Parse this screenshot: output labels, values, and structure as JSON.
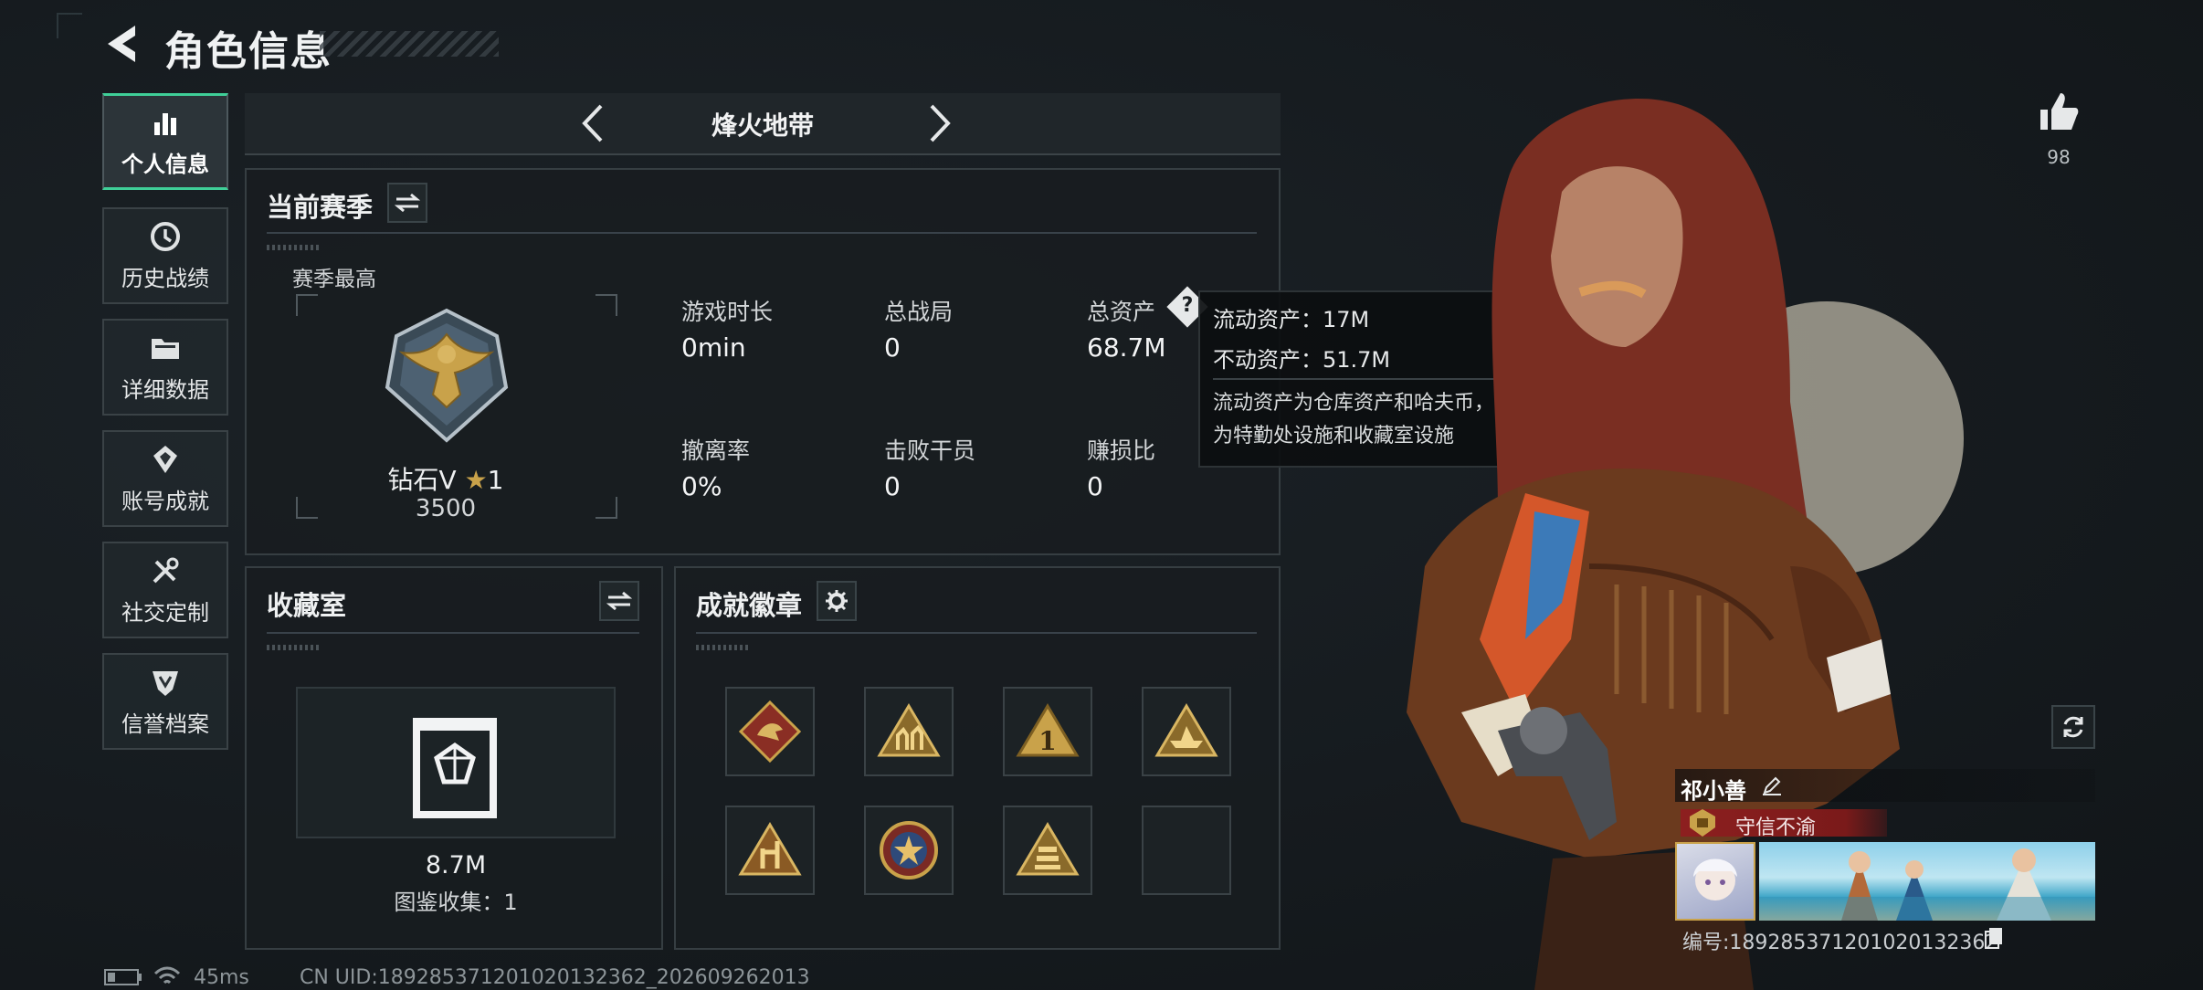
{
  "header": {
    "title": "角色信息"
  },
  "sidebar": {
    "items": [
      {
        "label": "个人信息",
        "icon": "bar-chart-icon",
        "active": true
      },
      {
        "label": "历史战绩",
        "icon": "clock-icon"
      },
      {
        "label": "详细数据",
        "icon": "folder-icon"
      },
      {
        "label": "账号成就",
        "icon": "achievement-icon"
      },
      {
        "label": "社交定制",
        "icon": "tools-icon"
      },
      {
        "label": "信誉档案",
        "icon": "shield-icon"
      }
    ]
  },
  "mode_selector": {
    "label": "烽火地带"
  },
  "season": {
    "title": "当前赛季",
    "best_label": "赛季最高",
    "rank_name": "钻石V",
    "rank_stars": "1",
    "rank_points": "3500",
    "stats": [
      {
        "label": "游戏时长",
        "value": "0min"
      },
      {
        "label": "总战局",
        "value": "0"
      },
      {
        "label": "总资产",
        "value": "68.7M"
      },
      {
        "label": "撤离率",
        "value": "0%"
      },
      {
        "label": "击败干员",
        "value": "0"
      },
      {
        "label": "赚损比",
        "value": "0"
      }
    ]
  },
  "tooltip": {
    "liquid": "流动资产：17M",
    "fixed": "不动资产：51.7M",
    "desc_line1": "流动资产为仓库资产和哈夫币，不动资产",
    "desc_line2": "为特勤处设施和收藏室设施"
  },
  "collection": {
    "title": "收藏室",
    "value": "8.7M",
    "catalog": "图鉴收集：1"
  },
  "badges": {
    "title": "成就徽章",
    "slots": [
      "dragon-badge",
      "soldiers-badge",
      "number-one-badge",
      "boat-badge",
      "rock-hand-badge",
      "star-emblem-badge",
      "stack-badge",
      "empty"
    ]
  },
  "player": {
    "likes": "98",
    "name": "祁小善",
    "tag": "守信不渝",
    "id": "编号:18928537120102013236​2"
  },
  "status": {
    "ping": "45ms",
    "uid": "CN UID:18928537120102013236​2_202609262013"
  },
  "colors": {
    "accent": "#3fcf98",
    "tag_red": "#8d1f1f",
    "gold": "#c9a24a"
  }
}
